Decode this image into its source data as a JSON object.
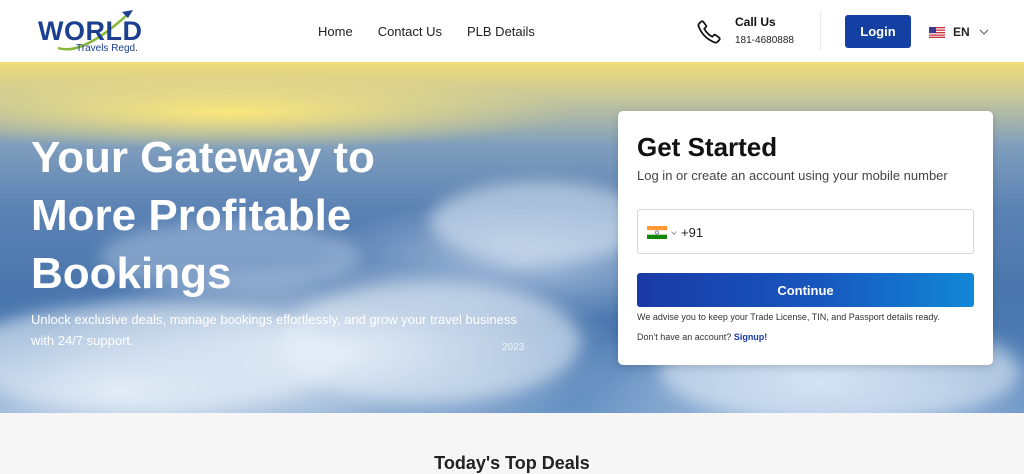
{
  "header": {
    "logo": {
      "word": "WORLD",
      "sub": "Travels Regd."
    },
    "nav": [
      {
        "label": "Home"
      },
      {
        "label": "Contact Us"
      },
      {
        "label": "PLB Details"
      }
    ],
    "call": {
      "label": "Call Us",
      "number": "181-4680888",
      "icon": "phone-icon"
    },
    "login_label": "Login",
    "language": {
      "code": "EN",
      "flag": "us-flag-icon"
    }
  },
  "hero": {
    "title": "Your Gateway to More Profitable Bookings",
    "subtitle": "Unlock exclusive deals, manage bookings effortlessly, and grow your travel business with 24/7 support.",
    "year": "2023"
  },
  "card": {
    "title": "Get Started",
    "subtitle": "Log in or create an account using your mobile number",
    "country_code": "+91",
    "country_flag": "india-flag-icon",
    "phone_value": "",
    "continue_label": "Continue",
    "advise": "We advise you to keep your Trade License, TIN, and Passport details ready.",
    "no_account": "Don't have an account?",
    "signup_label": "Signup!"
  },
  "deals": {
    "title": "Today's Top Deals"
  },
  "colors": {
    "brand": "#1540a3",
    "accent": "#1188d6",
    "text": "#111111"
  }
}
